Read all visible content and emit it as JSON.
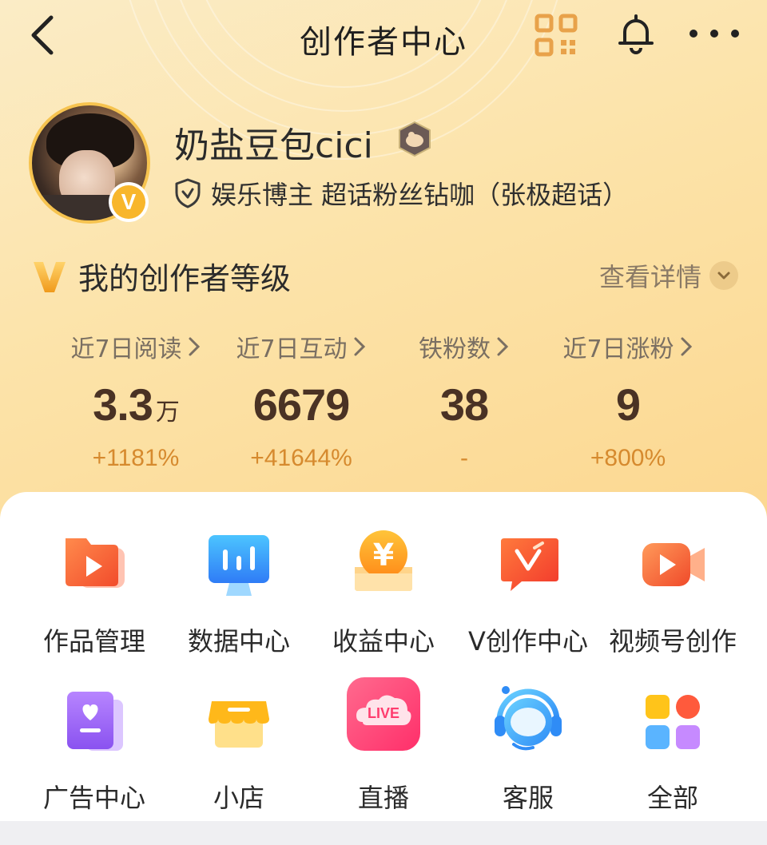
{
  "header": {
    "title": "创作者中心"
  },
  "profile": {
    "username": "奶盐豆包cici",
    "verification": "娱乐博主 超话粉丝钻咖（张极超话）",
    "verified_badge_letter": "V"
  },
  "creator_level": {
    "title": "我的创作者等级",
    "details_label": "查看详情"
  },
  "stats": [
    {
      "label": "近7日阅读",
      "value": "3.3",
      "unit": "万",
      "delta": "+1181%"
    },
    {
      "label": "近7日互动",
      "value": "6679",
      "unit": "",
      "delta": "+41644%"
    },
    {
      "label": "铁粉数",
      "value": "38",
      "unit": "",
      "delta": "-"
    },
    {
      "label": "近7日涨粉",
      "value": "9",
      "unit": "",
      "delta": "+800%"
    }
  ],
  "tools": [
    {
      "label": "作品管理",
      "icon": "folder-play-icon"
    },
    {
      "label": "数据中心",
      "icon": "data-chart-icon"
    },
    {
      "label": "收益中心",
      "icon": "yen-coin-icon"
    },
    {
      "label": "V创作中心",
      "icon": "v-creator-icon"
    },
    {
      "label": "视频号创作",
      "icon": "video-camera-icon"
    },
    {
      "label": "广告中心",
      "icon": "heart-card-icon"
    },
    {
      "label": "小店",
      "icon": "shop-icon"
    },
    {
      "label": "直播",
      "icon": "live-icon"
    },
    {
      "label": "客服",
      "icon": "headset-icon"
    },
    {
      "label": "全部",
      "icon": "all-grid-icon"
    }
  ],
  "live_icon_text": "LIVE",
  "colors": {
    "accent_orange": "#d68a2e",
    "gold": "#f6c34f",
    "value_brown": "#4a3224"
  }
}
